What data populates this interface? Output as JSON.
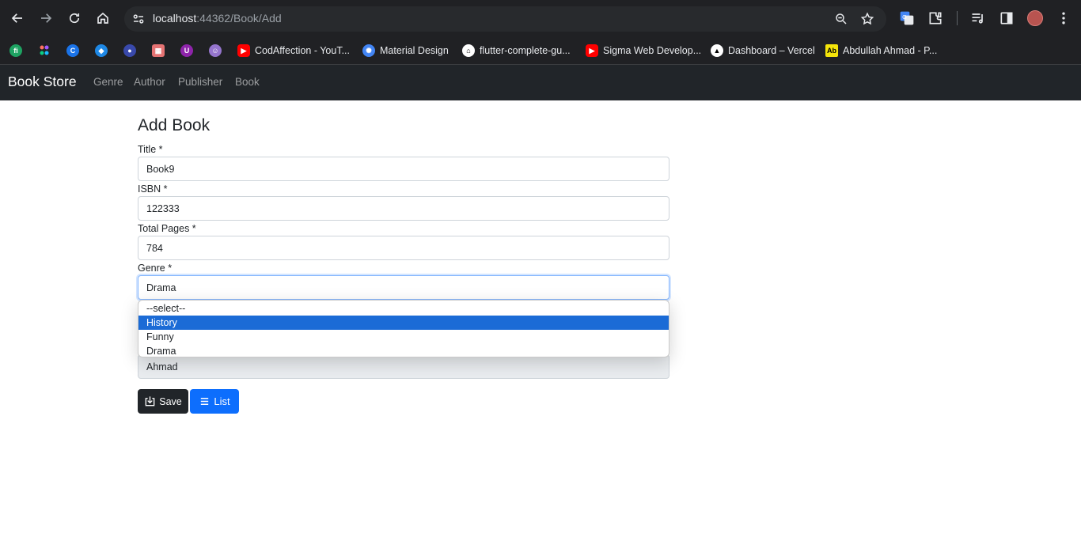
{
  "browser": {
    "url_host": "localhost",
    "url_path": ":44362/Book/Add",
    "bookmarks": [
      {
        "label": "",
        "icon": "fh-icon",
        "color": "#1ea362"
      },
      {
        "label": "",
        "icon": "figma-dots-icon",
        "color": "#ff7262"
      },
      {
        "label": "",
        "icon": "c-circle-icon",
        "color": "#1a73e8"
      },
      {
        "label": "",
        "icon": "drop-icon",
        "color": "#1e88e5"
      },
      {
        "label": "",
        "icon": "camera-icon",
        "color": "#5c6bc0"
      },
      {
        "label": "",
        "icon": "grid-icon",
        "color": "#e57373"
      },
      {
        "label": "",
        "icon": "u-icon",
        "color": "#8e24aa"
      },
      {
        "label": "",
        "icon": "avatar-icon",
        "color": "#9575cd"
      },
      {
        "label": "CodAffection - YouT...",
        "icon": "youtube-icon",
        "color": "#ff0000"
      },
      {
        "label": "Material Design",
        "icon": "material-icon",
        "color": "#4285f4"
      },
      {
        "label": "flutter-complete-gu...",
        "icon": "github-icon",
        "color": "#ffffff"
      },
      {
        "label": "Sigma Web Develop...",
        "icon": "youtube-icon",
        "color": "#ff0000"
      },
      {
        "label": "Dashboard – Vercel",
        "icon": "vercel-icon",
        "color": "#ffffff"
      },
      {
        "label": "Abdullah Ahmad - P...",
        "icon": "ab-icon",
        "color": "#f5e50a"
      }
    ]
  },
  "navbar": {
    "brand": "Book Store",
    "links": [
      "Genre",
      "Author",
      "Publisher",
      "Book"
    ]
  },
  "form": {
    "title": "Add Book",
    "fields": [
      {
        "label": "Title *",
        "value": "Book9"
      },
      {
        "label": "ISBN *",
        "value": "122333"
      },
      {
        "label": "Total Pages *",
        "value": "784"
      },
      {
        "label": "Genre *",
        "value": "Drama"
      }
    ],
    "hidden_field_value": "Ahmad",
    "genre_options": [
      "--select--",
      "History",
      "Funny",
      "Drama"
    ],
    "highlighted_option": "History",
    "save_label": "Save",
    "list_label": "List"
  }
}
